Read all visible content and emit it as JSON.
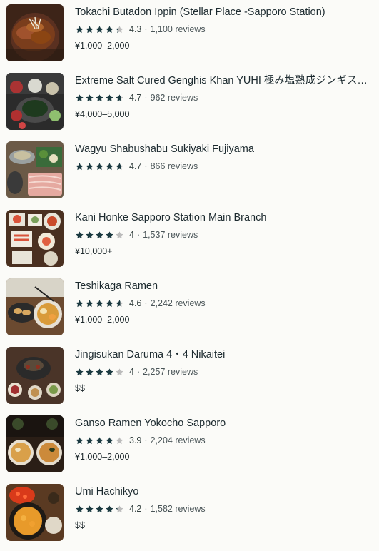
{
  "restaurants": [
    {
      "name": "Tokachi Butadon Ippin (Stellar Place -Sapporo Station)",
      "rating": "4.3",
      "rating_value": 4.3,
      "reviews": "1,100 reviews",
      "price": "¥1,000–2,000",
      "thumb": "rice-bowl"
    },
    {
      "name": "Extreme Salt Cured Genghis Khan YUHI 極み塩熟成ジンギス…",
      "rating": "4.7",
      "rating_value": 4.7,
      "reviews": "962 reviews",
      "price": "¥4,000–5,000",
      "thumb": "grill-platter"
    },
    {
      "name": "Wagyu Shabushabu Sukiyaki Fujiyama",
      "rating": "4.7",
      "rating_value": 4.7,
      "reviews": "866 reviews",
      "price": "",
      "thumb": "hot-pot"
    },
    {
      "name": "Kani Honke Sapporo Station Main Branch",
      "rating": "4",
      "rating_value": 4.0,
      "reviews": "1,537 reviews",
      "price": "¥10,000+",
      "thumb": "crab-set"
    },
    {
      "name": "Teshikaga Ramen",
      "rating": "4.6",
      "rating_value": 4.6,
      "reviews": "2,242 reviews",
      "price": "¥1,000–2,000",
      "thumb": "ramen-gyoza"
    },
    {
      "name": "Jingisukan Daruma 4・4 Nikaitei",
      "rating": "4",
      "rating_value": 4.0,
      "reviews": "2,257 reviews",
      "price": "$$",
      "thumb": "grill"
    },
    {
      "name": "Ganso Ramen Yokocho Sapporo",
      "rating": "3.9",
      "rating_value": 3.9,
      "reviews": "2,204 reviews",
      "price": "¥1,000–2,000",
      "thumb": "ramen"
    },
    {
      "name": "Umi Hachikyo",
      "rating": "4.2",
      "rating_value": 4.2,
      "reviews": "1,582 reviews",
      "price": "$$",
      "thumb": "ikura-bowl"
    }
  ],
  "separator": "·",
  "colors": {
    "star_filled": "#1a3940",
    "star_empty": "#bcbcbc",
    "background": "#fbfbf8"
  }
}
